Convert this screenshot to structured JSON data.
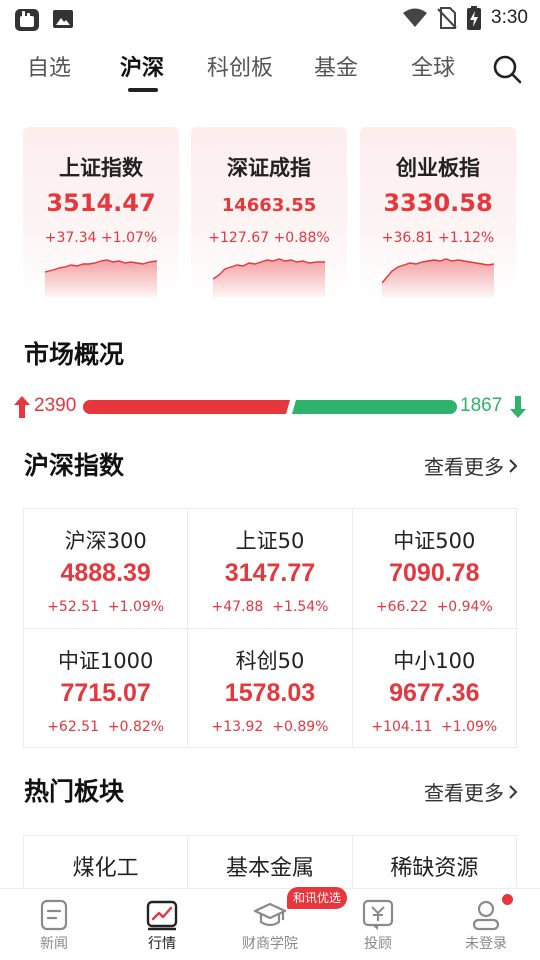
{
  "status_bar": {
    "time": "3:30",
    "left_icons": [
      "app-notification-icon",
      "image-icon"
    ],
    "right_icons": [
      "wifi-icon",
      "no-sim-icon",
      "battery-charging-icon"
    ]
  },
  "top_tabs": [
    {
      "label": "自选",
      "active": false
    },
    {
      "label": "沪深",
      "active": true
    },
    {
      "label": "科创板",
      "active": false
    },
    {
      "label": "基金",
      "active": false
    },
    {
      "label": "全球",
      "active": false
    }
  ],
  "index_cards": [
    {
      "name": "上证指数",
      "value": "3514.47",
      "change": "+37.34",
      "pct": "+1.07%"
    },
    {
      "name": "深证成指",
      "value": "14663.55",
      "change": "+127.67",
      "pct": "+0.88%"
    },
    {
      "name": "创业板指",
      "value": "3330.58",
      "change": "+36.81",
      "pct": "+1.12%"
    }
  ],
  "market_overview": {
    "title": "市场概况",
    "up_count": "2390",
    "down_count": "1867",
    "up_fraction": 0.561
  },
  "indices_section": {
    "title": "沪深指数",
    "more_label": "查看更多",
    "rows": [
      [
        {
          "name": "沪深300",
          "value": "4888.39",
          "change": "+52.51",
          "pct": "+1.09%"
        },
        {
          "name": "上证50",
          "value": "3147.77",
          "change": "+47.88",
          "pct": "+1.54%"
        },
        {
          "name": "中证500",
          "value": "7090.78",
          "change": "+66.22",
          "pct": "+0.94%"
        }
      ],
      [
        {
          "name": "中证1000",
          "value": "7715.07",
          "change": "+62.51",
          "pct": "+0.82%"
        },
        {
          "name": "科创50",
          "value": "1578.03",
          "change": "+13.92",
          "pct": "+0.89%"
        },
        {
          "name": "中小100",
          "value": "9677.36",
          "change": "+104.11",
          "pct": "+1.09%"
        }
      ]
    ]
  },
  "sectors_section": {
    "title": "热门板块",
    "more_label": "查看更多",
    "items": [
      "煤化工",
      "基本金属",
      "稀缺资源"
    ]
  },
  "bottom_nav": {
    "badge": "和讯优选",
    "items": [
      {
        "label": "新闻",
        "icon": "news-icon",
        "active": false
      },
      {
        "label": "行情",
        "icon": "market-chart-icon",
        "active": true
      },
      {
        "label": "财商学院",
        "icon": "graduation-cap-icon",
        "active": false
      },
      {
        "label": "投顾",
        "icon": "advisor-yuan-icon",
        "active": false
      },
      {
        "label": "未登录",
        "icon": "user-icon",
        "active": false
      }
    ]
  },
  "colors": {
    "rise": "#e6373d",
    "fall": "#2fb36a",
    "text": "#222222"
  }
}
